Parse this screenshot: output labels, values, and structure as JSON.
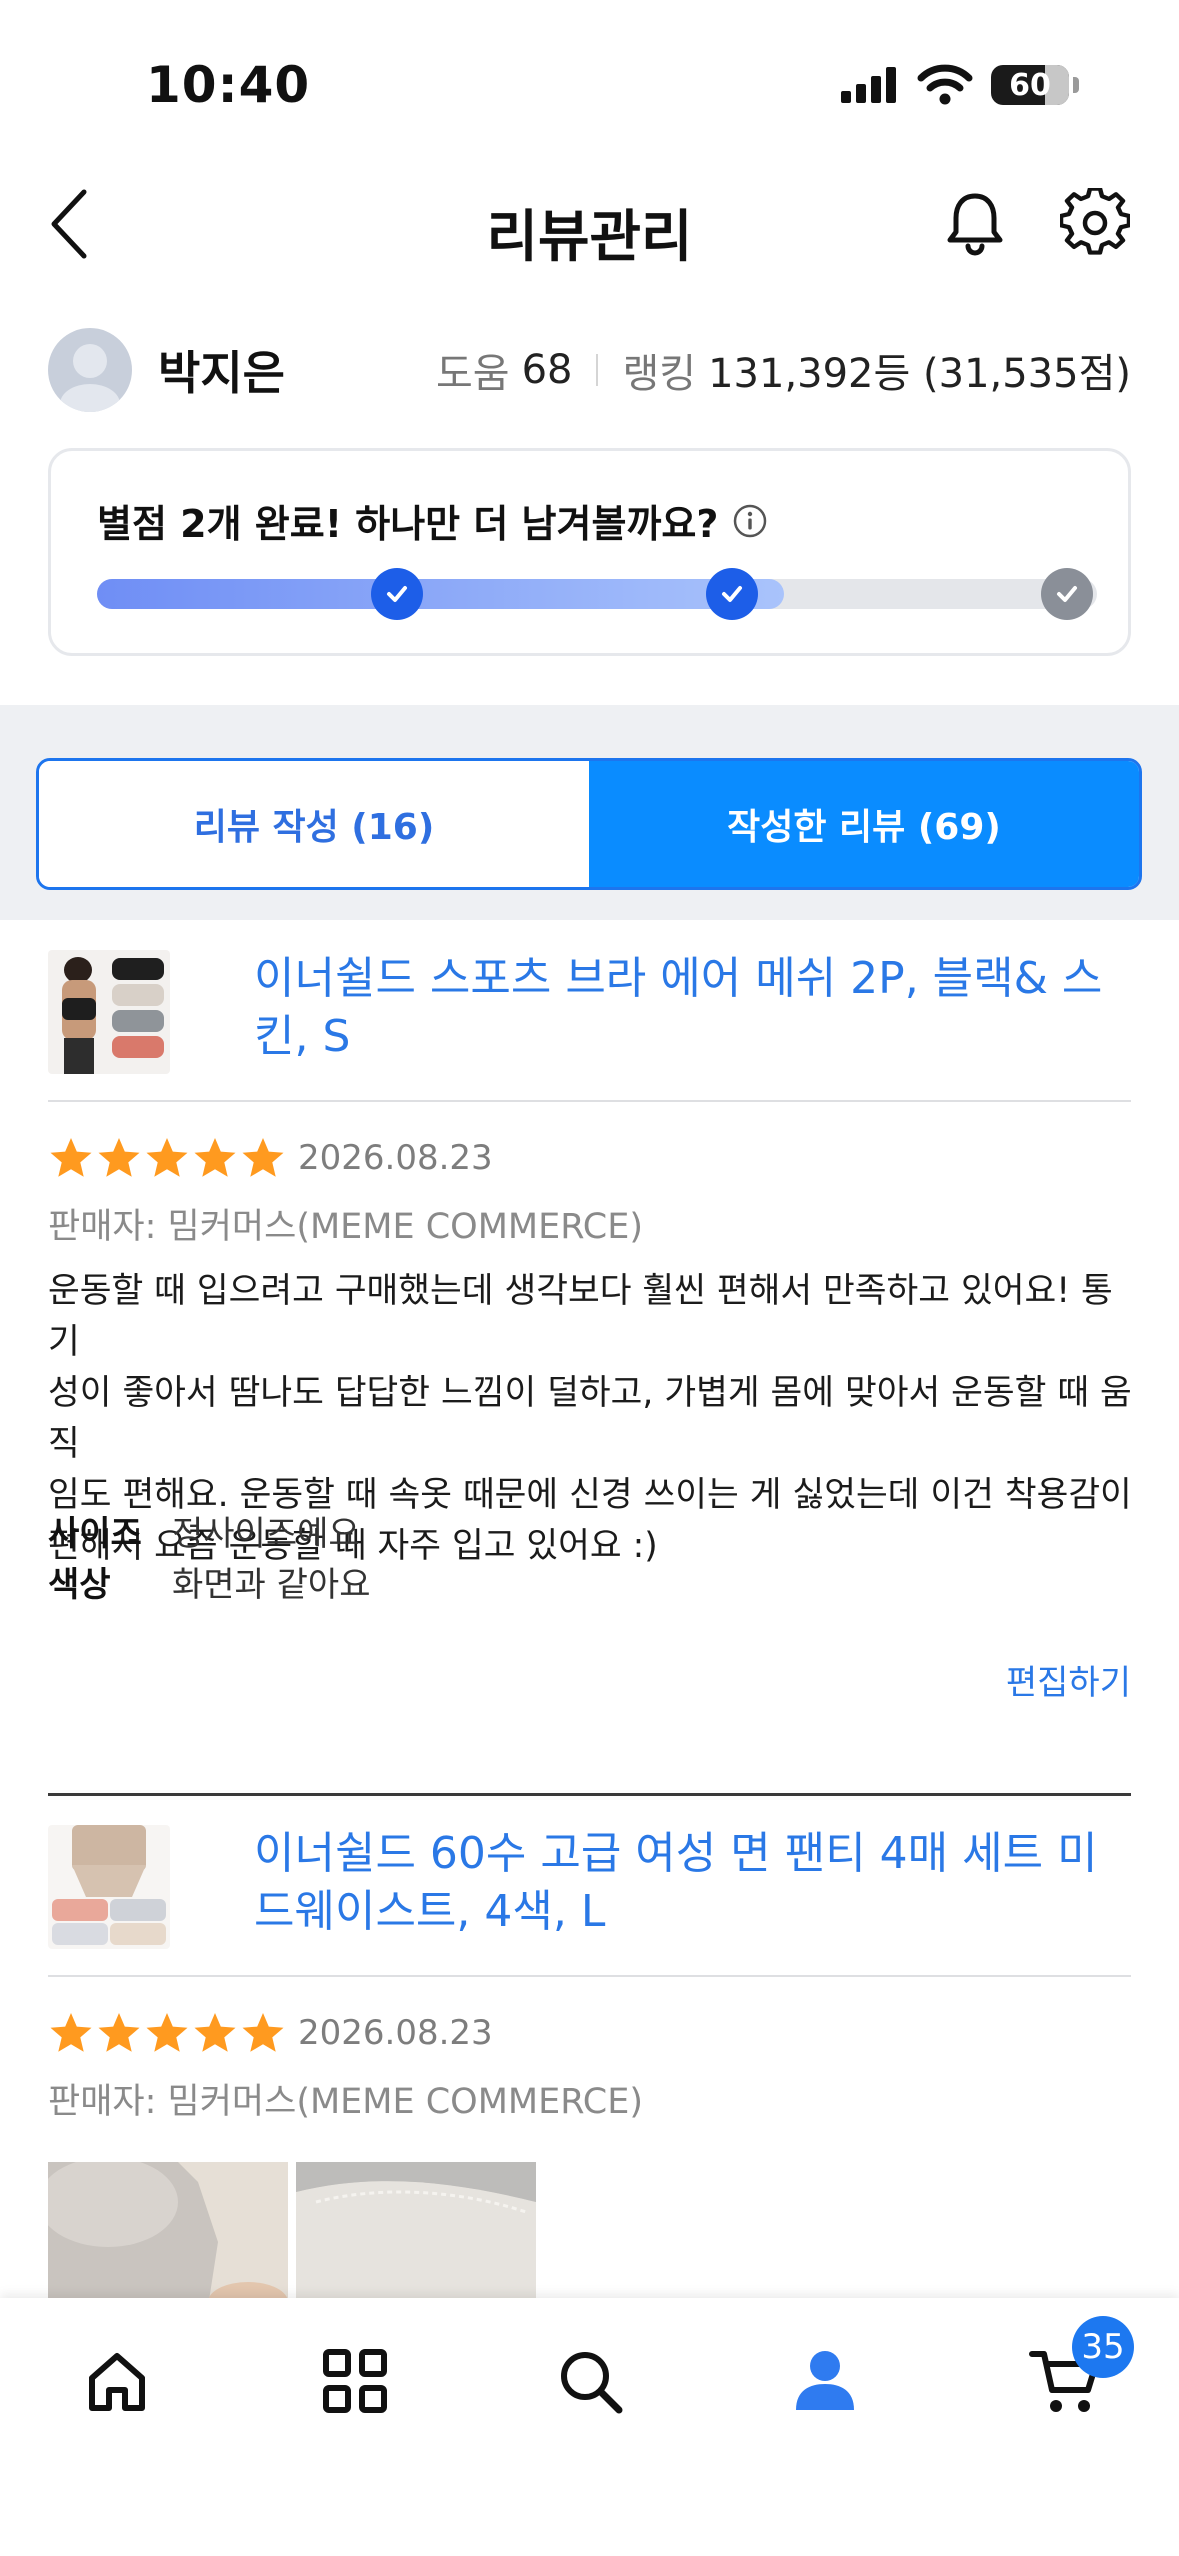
{
  "status_bar": {
    "time": "10:40",
    "battery": "60"
  },
  "header": {
    "title": "리뷰관리"
  },
  "profile": {
    "name": "박지은",
    "help_label": "도움",
    "help_value": "68",
    "ranking_label": "랭킹",
    "ranking_value": "131,392등 (31,535점)"
  },
  "progress": {
    "message": "별점 2개 완료! 하나만 더 남겨볼까요?",
    "completed_steps": 2,
    "total_steps": 3
  },
  "tabs": [
    {
      "label": "리뷰 작성 (16)",
      "active": false
    },
    {
      "label": "작성한 리뷰 (69)",
      "active": true
    }
  ],
  "reviews": [
    {
      "product_title": "이너쉴드 스포츠 브라 에어 메쉬 2P, 블랙& 스킨, S",
      "rating": 5,
      "date": "2026.08.23",
      "seller": "판매자: 밈커머스(MEME COMMERCE)",
      "body_lines": [
        "운동할 때 입으려고 구매했는데 생각보다 훨씬 편해서 만족하고 있어요! 통기",
        "성이 좋아서 땀나도 답답한 느낌이 덜하고, 가볍게 몸에 맞아서 운동할 때 움직",
        "임도 편해요. 운동할 때 속옷 때문에 신경 쓰이는 게 싫었는데 이건 착용감이",
        "편해서 요즘 운동할 때 자주 입고 있어요 :)"
      ],
      "attributes": [
        {
          "label": "사이즈",
          "value": "정사이즈예요"
        },
        {
          "label": "색상",
          "value": "화면과 같아요"
        }
      ],
      "edit_label": "편집하기"
    },
    {
      "product_title": "이너쉴드 60수 고급 여성 면 팬티 4매 세트 미드웨이스트, 4색, L",
      "rating": 5,
      "date": "2026.08.23",
      "seller": "판매자: 밈커머스(MEME COMMERCE)"
    }
  ],
  "bottom_nav": {
    "cart_count": "35"
  },
  "colors": {
    "accent": "#0a8cff",
    "link": "#2a78e6",
    "star": "#ff9a1f"
  }
}
